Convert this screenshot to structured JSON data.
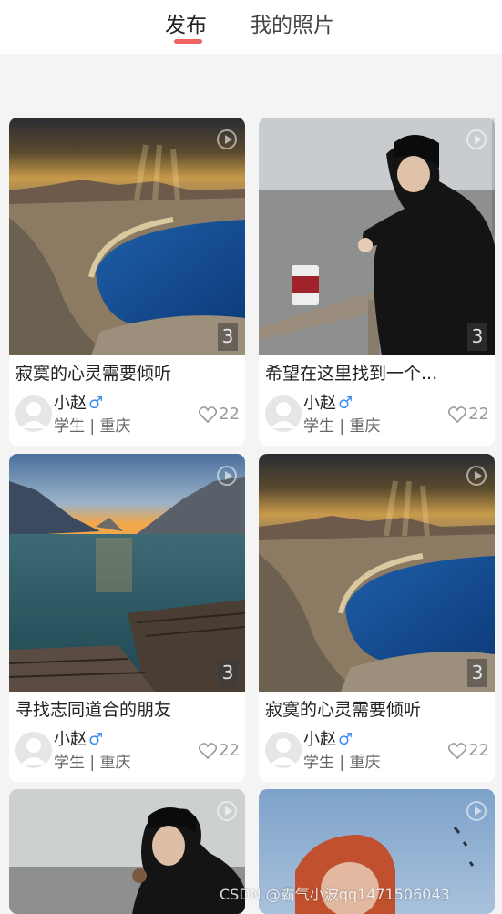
{
  "tabs": [
    {
      "label": "发布",
      "active": true
    },
    {
      "label": "我的照片",
      "active": false
    }
  ],
  "accent_color": "#f06363",
  "gender_color": "#3d8cf0",
  "cards": [
    {
      "title": "寂寞的心灵需要倾听",
      "name": "小赵",
      "gender": "♂",
      "meta": "学生 | 重庆",
      "likes": "22",
      "photo_count": "3",
      "scene": "seaside-cliff"
    },
    {
      "title": "希望在这里找到一个...",
      "name": "小赵",
      "gender": "♂",
      "meta": "学生 | 重庆",
      "likes": "22",
      "photo_count": "3",
      "scene": "man-by-sea"
    },
    {
      "title": "寻找志同道合的朋友",
      "name": "小赵",
      "gender": "♂",
      "meta": "学生 | 重庆",
      "likes": "22",
      "photo_count": "3",
      "scene": "mountain-lake"
    },
    {
      "title": "寂寞的心灵需要倾听",
      "name": "小赵",
      "gender": "♂",
      "meta": "学生 | 重庆",
      "likes": "22",
      "photo_count": "3",
      "scene": "seaside-cliff"
    },
    {
      "scene": "man-by-sea"
    },
    {
      "scene": "redhead-sky"
    }
  ],
  "watermark": "CSDN @霸气小波qq1471506043"
}
